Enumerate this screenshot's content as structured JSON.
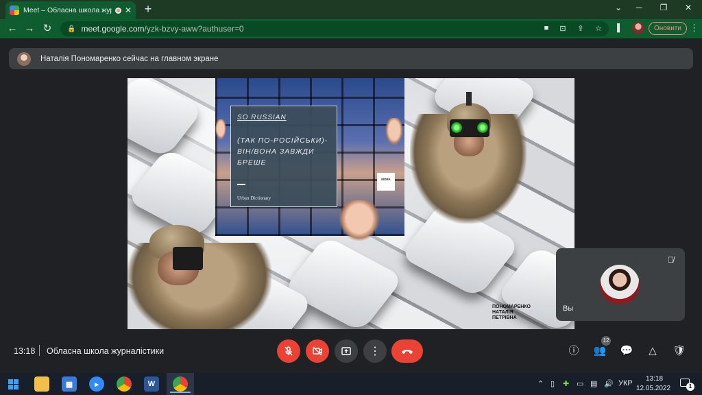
{
  "browser": {
    "tab_title": "Meet – Обласна школа журналістики",
    "new_tab": "+",
    "url_host": "meet.google.com",
    "url_path": "/yzk-bzvy-aww?authuser=0",
    "update_button": "Оновити"
  },
  "banner": {
    "text": "Наталія Пономаренко сейчас на главном экране"
  },
  "presentation": {
    "card_title": "SO RUSSIAN",
    "card_body": "(ТАК ПО-РОСІЙСЬКИ)- ВІН/ВОНА ЗАВЖДИ БРЕШЕ",
    "card_source": "Urban Dictionary",
    "logo_text": "МОВА",
    "signature": "ПОНОМАРЕНКО НАТАЛІЯ ПЕТРІВНА"
  },
  "self_tile": {
    "label": "Вы"
  },
  "bottom_bar": {
    "time": "13:18",
    "meeting_name": "Обласна школа журналістики",
    "people_count": "12"
  },
  "taskbar": {
    "word_label": "W",
    "language": "УКР",
    "time": "13:18",
    "date": "12.05.2022",
    "notification_count": "1"
  },
  "colors": {
    "browser_frame": "#0e5c2f",
    "meet_background": "#202124",
    "danger": "#ea4335",
    "tile": "#3c4043"
  }
}
